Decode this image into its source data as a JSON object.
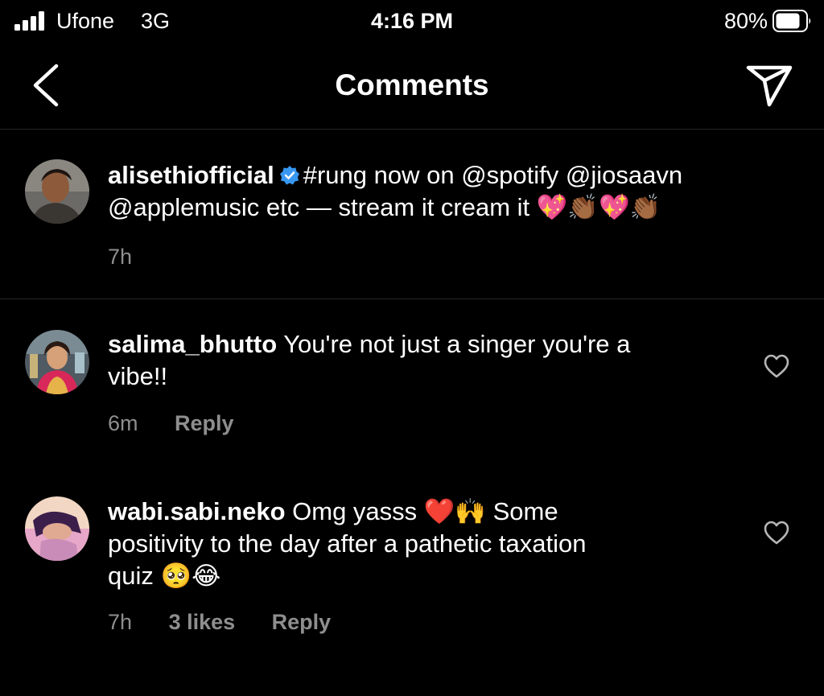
{
  "status_bar": {
    "carrier": "Ufone",
    "network": "3G",
    "time": "4:16 PM",
    "battery": "80%"
  },
  "nav": {
    "title": "Comments",
    "back_icon": "chevron-left-icon",
    "share_icon": "paper-plane-icon"
  },
  "caption": {
    "username": "alisethiofficial",
    "verified": true,
    "text": "#rung now on @spotify @jiosaavn",
    "text_line2": "@applemusic etc — stream it cream it",
    "emojis": "💖👏🏾💖👏🏾",
    "time": "7h"
  },
  "comments": [
    {
      "username": "salima_bhutto",
      "text": "You're not just a singer you're a",
      "text_line2": "vibe!!",
      "time": "6m",
      "reply_label": "Reply"
    },
    {
      "username": "wabi.sabi.neko",
      "text": "Omg yasss",
      "emojis_inline": "❤️🙌",
      "text_cont": "Some",
      "text_line2": "positivity to the day after a pathetic taxation",
      "text_line3": "quiz",
      "emojis_end": "🥺😂",
      "time": "7h",
      "likes": "3 likes",
      "reply_label": "Reply"
    }
  ],
  "colors": {
    "background": "#000000",
    "text": "#ffffff",
    "secondary": "#8e8e8e",
    "verified": "#3897f0",
    "divider": "#262626"
  }
}
